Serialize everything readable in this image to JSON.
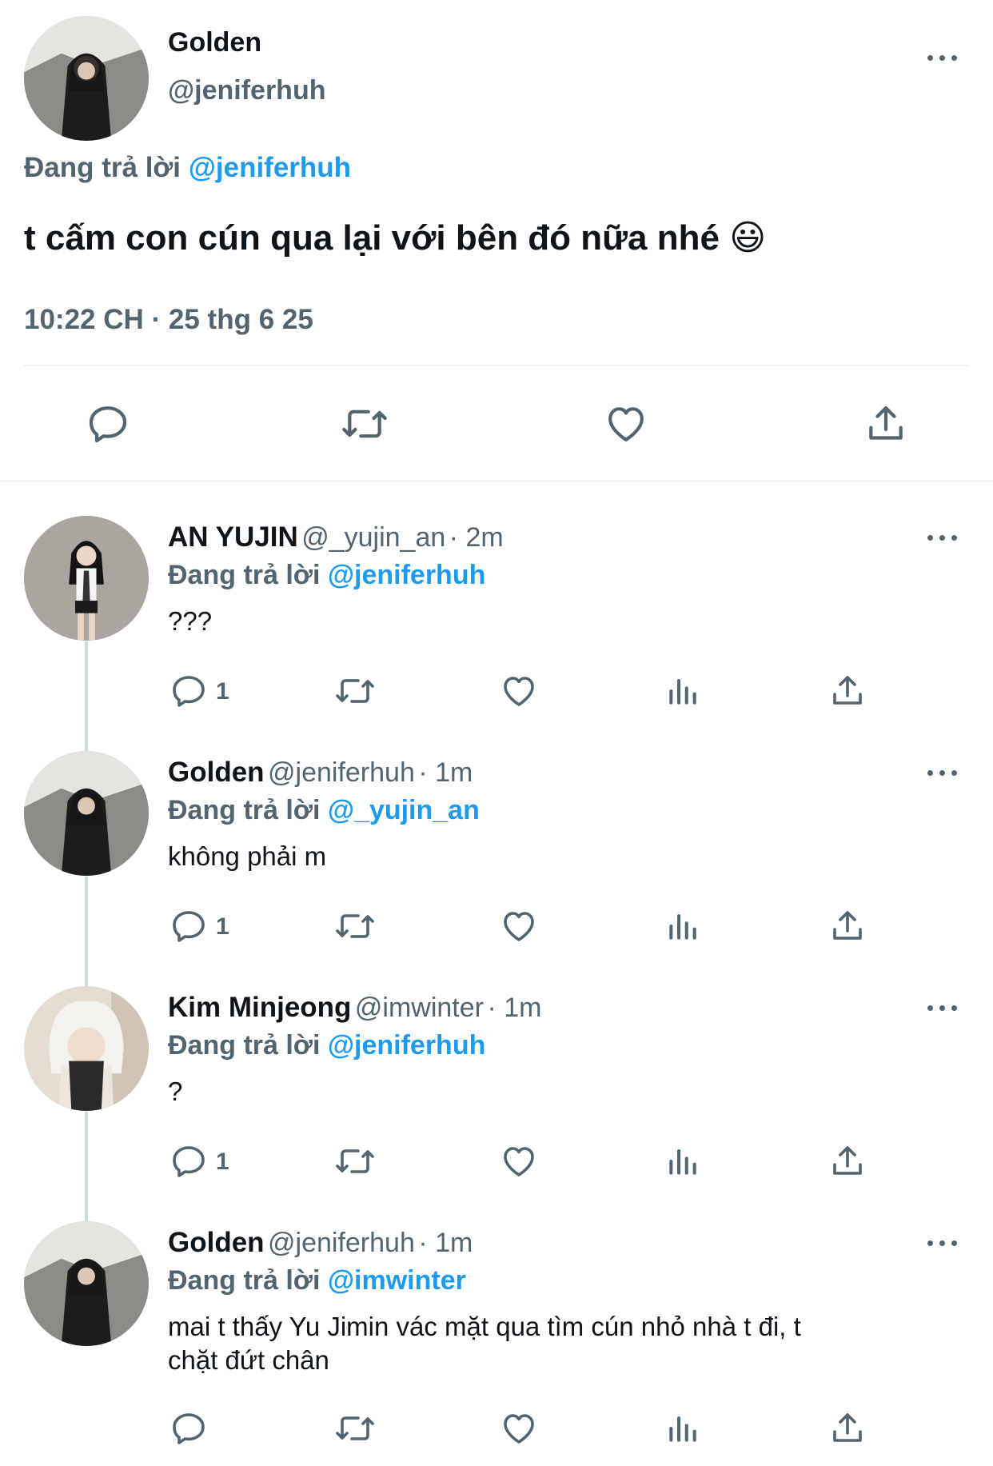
{
  "main_tweet": {
    "display_name": "Golden",
    "handle": "@jeniferhuh",
    "replying_prefix": "Đang trả lời",
    "replying_to": "@jeniferhuh",
    "text": "t cấm con cún qua lại với bên đó nữa nhé",
    "emoji": "😃",
    "timestamp": "10:22 CH · 25 thg 6 25"
  },
  "replies": [
    {
      "display_name": "AN YUJIN",
      "handle": "@_yujin_an",
      "time": "· 2m",
      "replying_prefix": "Đang trả lời",
      "replying_to": "@jeniferhuh",
      "text": "???",
      "reply_count": "1"
    },
    {
      "display_name": "Golden",
      "handle": "@jeniferhuh",
      "time": "· 1m",
      "replying_prefix": "Đang trả lời",
      "replying_to": "@_yujin_an",
      "text": "không phải m",
      "reply_count": "1"
    },
    {
      "display_name": "Kim Minjeong",
      "handle": "@imwinter",
      "time": "· 1m",
      "replying_prefix": "Đang trả lời",
      "replying_to": "@jeniferhuh",
      "text": "?",
      "reply_count": "1"
    },
    {
      "display_name": "Golden",
      "handle": "@jeniferhuh",
      "time": "· 1m",
      "replying_prefix": "Đang trả lời",
      "replying_to": "@imwinter",
      "text_line1": "mai t thấy Yu Jimin vác mặt qua tìm cún nhỏ nhà t đi, t",
      "text_line2": "chặt đứt chân",
      "reply_count": ""
    }
  ],
  "icons": {
    "reply": "speech-bubble-icon",
    "retweet": "retweet-arrows-icon",
    "like": "heart-icon",
    "views": "bar-chart-icon",
    "share": "share-upload-icon",
    "more": "more-dots-icon"
  },
  "colors": {
    "text": "#0f1419",
    "secondary": "#536471",
    "link": "#1d9bf0",
    "divider": "#eff3f4"
  }
}
